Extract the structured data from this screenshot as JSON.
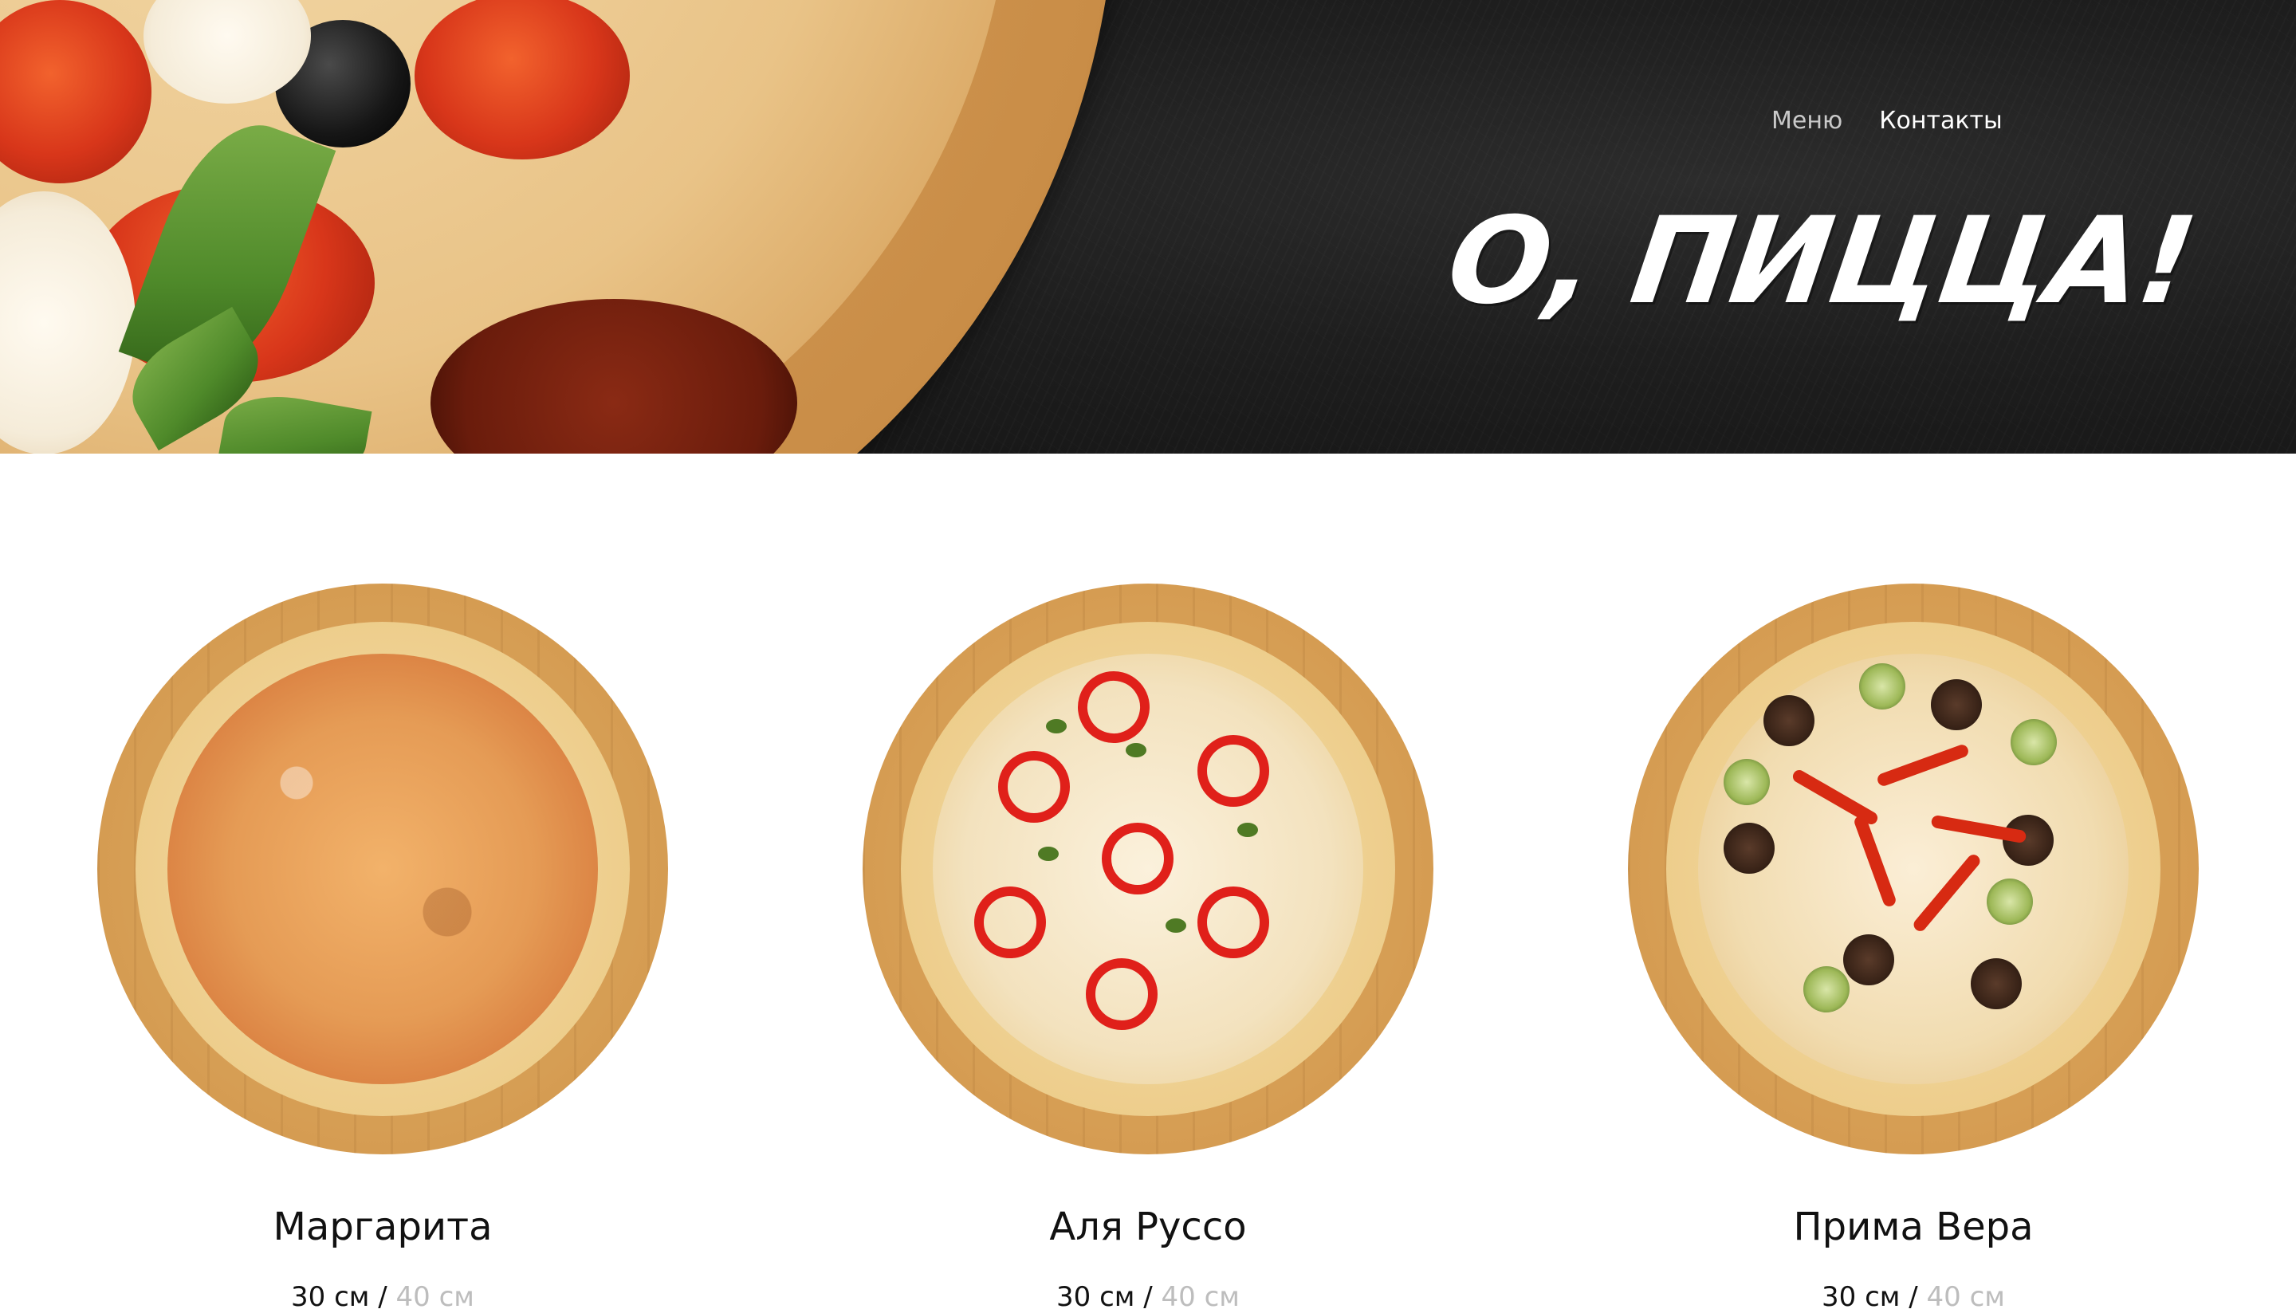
{
  "header": {
    "nav": [
      {
        "label": "Меню",
        "active": false
      },
      {
        "label": "Контакты",
        "active": true
      }
    ],
    "logo_text": "О, ПИЦЦА!"
  },
  "products": [
    {
      "name": "Маргарита",
      "sizes": [
        "30 см",
        "40 см"
      ],
      "size_separator": "/",
      "selected_size": "30 см"
    },
    {
      "name": "Аля Руссо",
      "sizes": [
        "30 см",
        "40 см"
      ],
      "size_separator": "/",
      "selected_size": "30 см"
    },
    {
      "name": "Прима Вера",
      "sizes": [
        "30 см",
        "40 см"
      ],
      "size_separator": "/",
      "selected_size": "30 см"
    }
  ],
  "colors": {
    "hero_background": "#1e1e1e",
    "text": "#111111",
    "inactive_size": "#bdbdbd",
    "nav_active": "#ffffff",
    "nav_muted": "#c9c9c9"
  }
}
